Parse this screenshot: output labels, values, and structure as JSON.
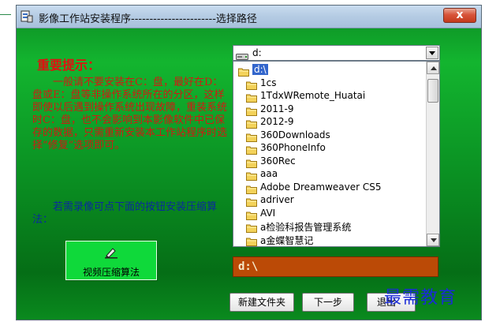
{
  "window": {
    "title": "影像工作站安装程序-----------------------选择路径",
    "close_label": "x"
  },
  "notice": {
    "heading": "重要提示：",
    "body": "一般请不要安装在C：盘，最好在D：盘或E：盘等非操作系统所在的分区，这样即使以后遇到操作系统出现故障，重装系统时C：盘，也不会影响到本影像软件中已保存的数据，只需重新安装本工作站程序时选择“修复”选项即可。"
  },
  "compress": {
    "hint": "若需录像可点下面的按钮安装压缩算法：",
    "button_label": "视频压缩算法",
    "icon": "pencil-icon"
  },
  "drive": {
    "selected": "d:",
    "icon": "drive-icon"
  },
  "folders": [
    {
      "label": "d:\\",
      "selected": true,
      "indent": 0
    },
    {
      "label": "1cs",
      "indent": 1
    },
    {
      "label": "1TdxWRemote_Huatai",
      "indent": 1
    },
    {
      "label": "2011-9",
      "indent": 1
    },
    {
      "label": "2012-9",
      "indent": 1
    },
    {
      "label": "360Downloads",
      "indent": 1
    },
    {
      "label": "360PhoneInfo",
      "indent": 1
    },
    {
      "label": "360Rec",
      "indent": 1
    },
    {
      "label": "aaa",
      "indent": 1
    },
    {
      "label": "Adobe Dreamweaver CS5",
      "indent": 1
    },
    {
      "label": "adriver",
      "indent": 1
    },
    {
      "label": "AVI",
      "indent": 1
    },
    {
      "label": "a检验科报告管理系统",
      "indent": 1
    },
    {
      "label": "a金蝶智慧记",
      "indent": 1
    }
  ],
  "path": {
    "value": "d:\\"
  },
  "buttons": {
    "new_folder": "新建文件夹",
    "next": "下一步",
    "exit": "退出"
  },
  "watermark": "最需教育",
  "colors": {
    "window_green": "#0fa52a",
    "notice_red": "#e01010",
    "hint_blue": "#0a2a9c",
    "path_bg": "#bb4a06",
    "selection_blue": "#3366cc",
    "watermark_blue": "#1a2bd6"
  }
}
